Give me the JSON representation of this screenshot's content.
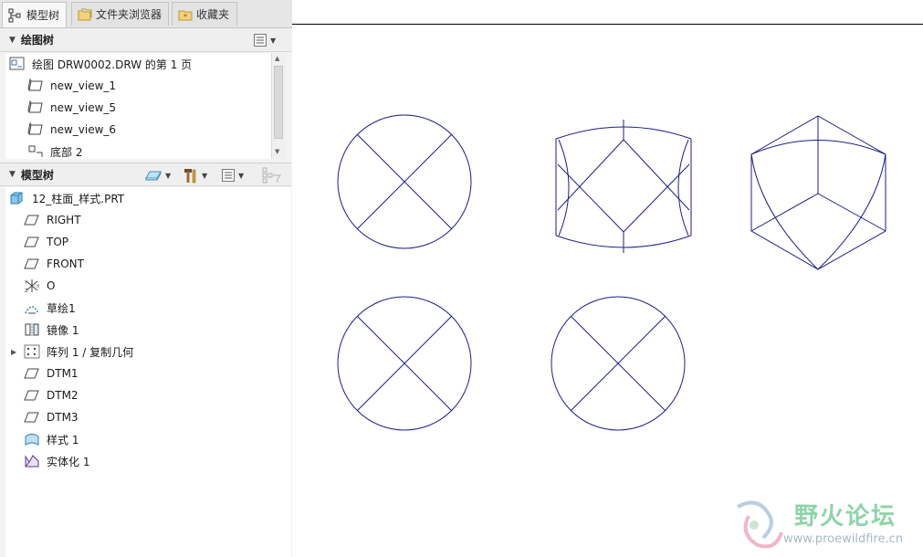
{
  "tabs": [
    {
      "label": "模型树",
      "icon": "model-tree-icon",
      "active": true
    },
    {
      "label": "文件夹浏览器",
      "icon": "folder-browser-icon",
      "active": false
    },
    {
      "label": "收藏夹",
      "icon": "favorites-icon",
      "active": false
    }
  ],
  "drawing_tree": {
    "header": "绘图树",
    "items": [
      {
        "label": "绘图 DRW0002.DRW 的第 1 页",
        "icon": "drawing-sheet-icon"
      },
      {
        "label": "new_view_1",
        "icon": "view-icon"
      },
      {
        "label": "new_view_5",
        "icon": "view-icon"
      },
      {
        "label": "new_view_6",
        "icon": "view-icon"
      },
      {
        "label": "底部 2",
        "icon": "view-icon"
      }
    ]
  },
  "model_tree": {
    "header": "模型树",
    "items": [
      {
        "label": "12_柱面_样式.PRT",
        "icon": "part-icon"
      },
      {
        "label": "RIGHT",
        "icon": "datum-plane-icon"
      },
      {
        "label": "TOP",
        "icon": "datum-plane-icon"
      },
      {
        "label": "FRONT",
        "icon": "datum-plane-icon"
      },
      {
        "label": "O",
        "icon": "coordinate-system-icon"
      },
      {
        "label": "草绘1",
        "icon": "sketch-icon"
      },
      {
        "label": "镜像 1",
        "icon": "mirror-icon"
      },
      {
        "label": "阵列 1 / 复制几何",
        "icon": "pattern-icon",
        "expandable": true
      },
      {
        "label": "DTM1",
        "icon": "datum-plane-icon"
      },
      {
        "label": "DTM2",
        "icon": "datum-plane-icon"
      },
      {
        "label": "DTM3",
        "icon": "datum-plane-icon"
      },
      {
        "label": "样式 1",
        "icon": "style-icon"
      },
      {
        "label": "实体化 1",
        "icon": "solidify-icon"
      }
    ]
  },
  "watermark": {
    "title": "野火论坛",
    "url": "www.proewildfire.cn"
  },
  "colors": {
    "view_line": "#1e1e8c",
    "watermark_green": "#8fd3a8",
    "watermark_gray": "#a7b8c8"
  }
}
